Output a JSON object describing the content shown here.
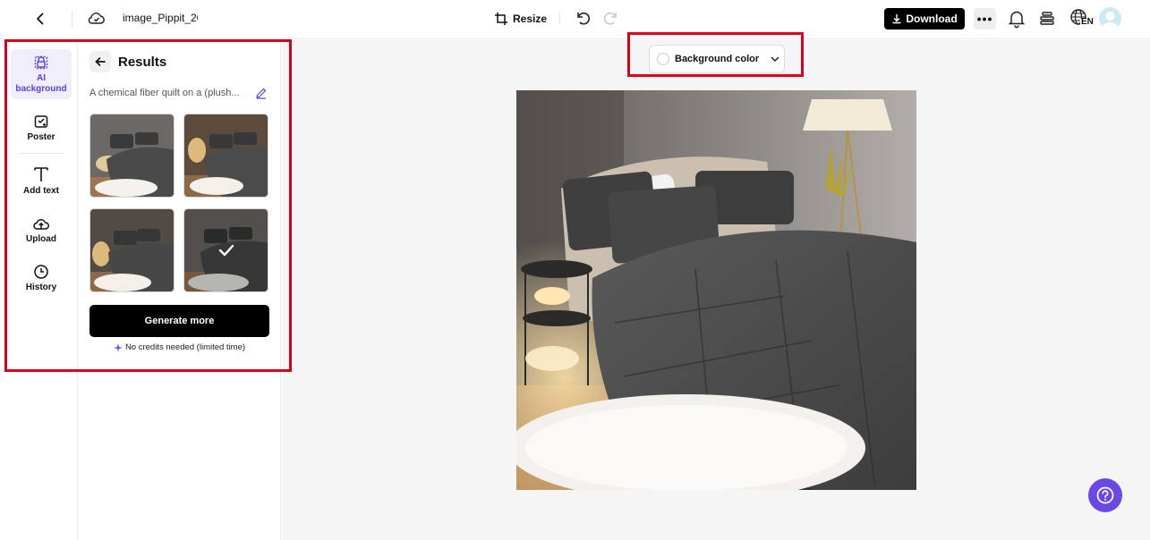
{
  "header": {
    "filename": "image_Pippit_20",
    "resize_label": "Resize",
    "download_label": "Download",
    "more_label": "•••",
    "language_code": "EN"
  },
  "rail": {
    "items": [
      {
        "label": "AI background",
        "icon": "ai-background-icon",
        "active": true
      },
      {
        "label": "Poster",
        "icon": "poster-icon"
      },
      {
        "label": "Add text",
        "icon": "text-icon"
      },
      {
        "label": "Upload",
        "icon": "upload-icon"
      },
      {
        "label": "History",
        "icon": "history-icon"
      }
    ]
  },
  "panel": {
    "title": "Results",
    "prompt": "A chemical fiber quilt on a (plush...",
    "generate_label": "Generate more",
    "credits_note": "No credits needed (limited time)",
    "selected_result": 4
  },
  "canvas": {
    "background_color_label": "Background color"
  },
  "colors": {
    "accent": "#6a48e8",
    "highlight": "#d9001b",
    "button_dark": "#000000"
  }
}
